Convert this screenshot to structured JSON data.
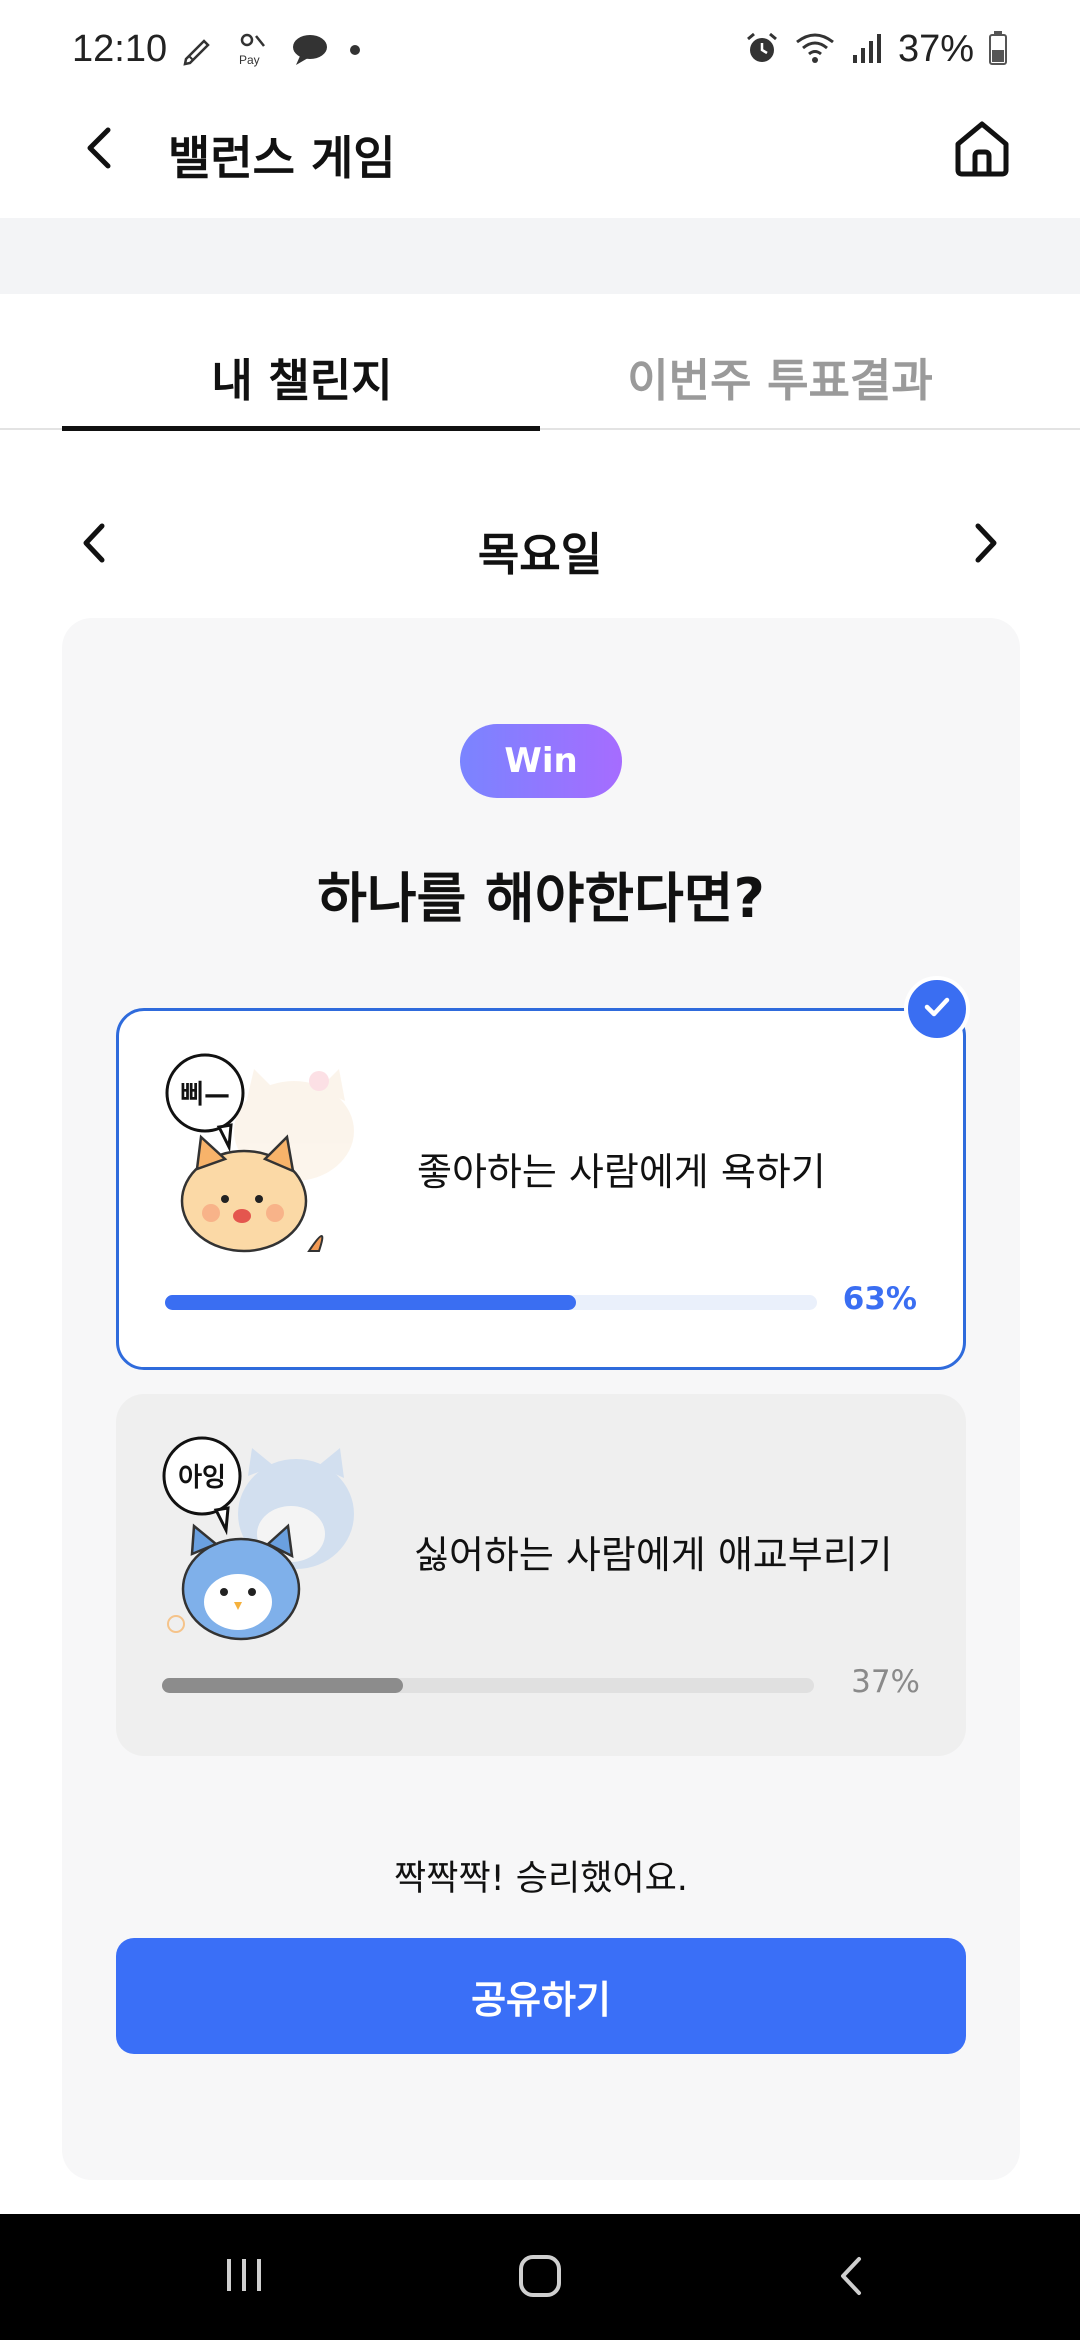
{
  "status_bar": {
    "time": "12:10",
    "battery": "37%",
    "left_icons": [
      "pencil-icon",
      "samsung-pay-icon",
      "chat-bubble-icon",
      "dot-icon"
    ],
    "right_icons": [
      "alarm-icon",
      "wifi-icon",
      "signal-icon",
      "battery-icon"
    ]
  },
  "header": {
    "title": "밸런스 게임",
    "back_icon": "back-arrow-icon",
    "home_icon": "home-icon"
  },
  "tabs": [
    {
      "label": "내 챌린지",
      "active": true
    },
    {
      "label": "이번주 투표결과",
      "active": false
    }
  ],
  "day_nav": {
    "label": "목요일"
  },
  "card": {
    "badge": "Win",
    "question": "하나를 해야한다면?",
    "options": [
      {
        "text": "좋아하는 사람에게 욕하기",
        "percent_label": "63%",
        "percent": 63,
        "bubble": "삐—",
        "selected": true
      },
      {
        "text": "싫어하는 사람에게 애교부리기",
        "percent_label": "37%",
        "percent": 37,
        "bubble": "아잉",
        "selected": false
      }
    ],
    "result_message": "짝짝짝! 승리했어요.",
    "share_label": "공유하기"
  },
  "colors": {
    "accent": "#3a6ef2",
    "badge_gradient_start": "#7a84ff",
    "badge_gradient_end": "#a66cff",
    "card_bg": "#f7f7f8"
  }
}
